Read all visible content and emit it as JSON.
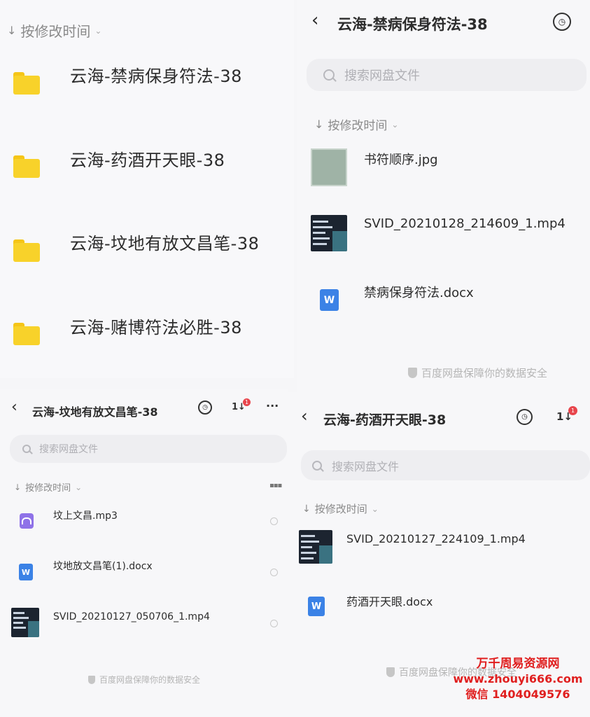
{
  "panel_folders": {
    "sort_label": "按修改时间",
    "folders": [
      {
        "name": "云海-禁病保身符法-38"
      },
      {
        "name": "云海-药酒开天眼-38"
      },
      {
        "name": "云海-坟地有放文昌笔-38"
      },
      {
        "name": "云海-赌博符法必胜-38"
      }
    ]
  },
  "panel_jinbing": {
    "title": "云海-禁病保身符法-38",
    "search_placeholder": "搜索网盘文件",
    "sort_label": "按修改时间",
    "files": [
      {
        "name": "书符顺序.jpg",
        "type": "image"
      },
      {
        "name": "SVID_20210128_214609_1.mp4",
        "type": "video"
      },
      {
        "name": "禁病保身符法.docx",
        "type": "docx"
      }
    ],
    "security_note": "百度网盘保障你的数据安全"
  },
  "panel_fendi": {
    "title": "云海-坟地有放文昌笔-38",
    "search_placeholder": "搜索网盘文件",
    "sort_label": "按修改时间",
    "transfer_badge": "1",
    "files": [
      {
        "name": "坟上文昌.mp3",
        "type": "audio"
      },
      {
        "name": "坟地放文昌笔(1).docx",
        "type": "docx"
      },
      {
        "name": "SVID_20210127_050706_1.mp4",
        "type": "video"
      }
    ],
    "security_note": "百度网盘保障你的数据安全"
  },
  "panel_yaojiu": {
    "title": "云海-药酒开天眼-38",
    "search_placeholder": "搜索网盘文件",
    "sort_label": "按修改时间",
    "transfer_badge": "1",
    "files": [
      {
        "name": "SVID_20210127_224109_1.mp4",
        "type": "video"
      },
      {
        "name": "药酒开天眼.docx",
        "type": "docx"
      }
    ],
    "security_note": "百度网盘保障你的数据安全"
  },
  "icons": {
    "doc_letter": "W",
    "transfer_glyph": "1↓"
  },
  "watermark": {
    "line1": "万千周易资源网",
    "line2": "www.zhouyi666.com",
    "line3": "微信 1404049576",
    "color": "#e01f1f"
  }
}
